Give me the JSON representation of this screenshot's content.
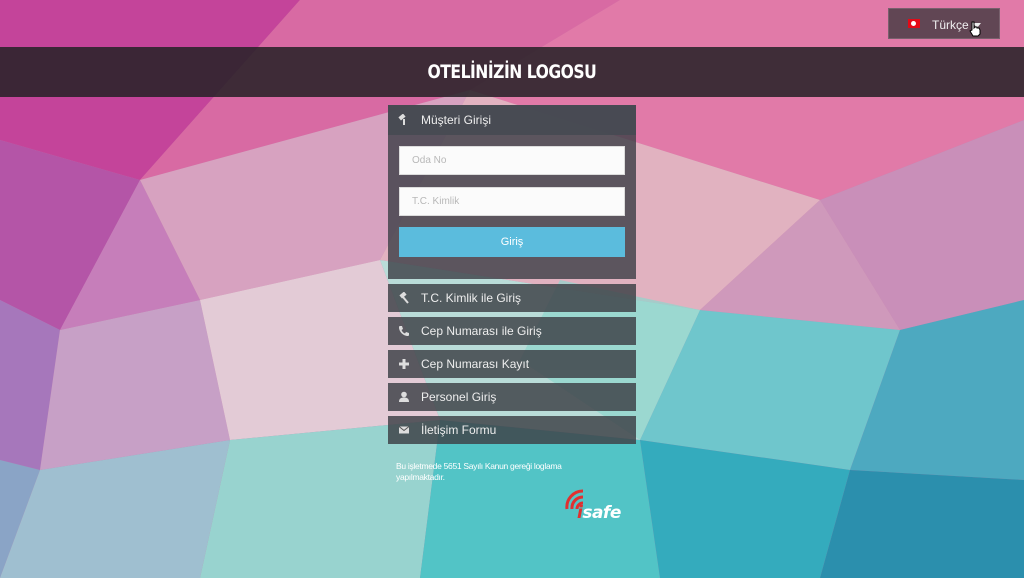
{
  "language": {
    "selected": "Türkçe",
    "flag_icon": "turkey-flag-icon"
  },
  "header": {
    "logo_text": "OTELİNİZİN LOGOSU"
  },
  "login_panel": {
    "title": "Müşteri Girişi",
    "room_no": {
      "placeholder": "Oda No",
      "value": ""
    },
    "tc_id": {
      "placeholder": "T.C. Kimlik",
      "value": ""
    },
    "submit_label": "Giriş"
  },
  "menu": [
    {
      "label": "T.C. Kimlik ile Giriş",
      "icon": "gavel-icon"
    },
    {
      "label": "Cep Numarası ile Giriş",
      "icon": "phone-icon"
    },
    {
      "label": "Cep Numarası Kayıt",
      "icon": "plus-icon"
    },
    {
      "label": "Personel Giriş",
      "icon": "user-icon"
    },
    {
      "label": "İletişim Formu",
      "icon": "envelope-icon"
    }
  ],
  "footer": {
    "notice": "Bu işletmede 5651 Sayılı Kanun gereği loglama yapılmaktadır.",
    "brand_i": "i",
    "brand_rest": "safe"
  },
  "colors": {
    "accent": "#5bbcdd",
    "panel": "#3e4148",
    "brand_red": "#e03030"
  }
}
